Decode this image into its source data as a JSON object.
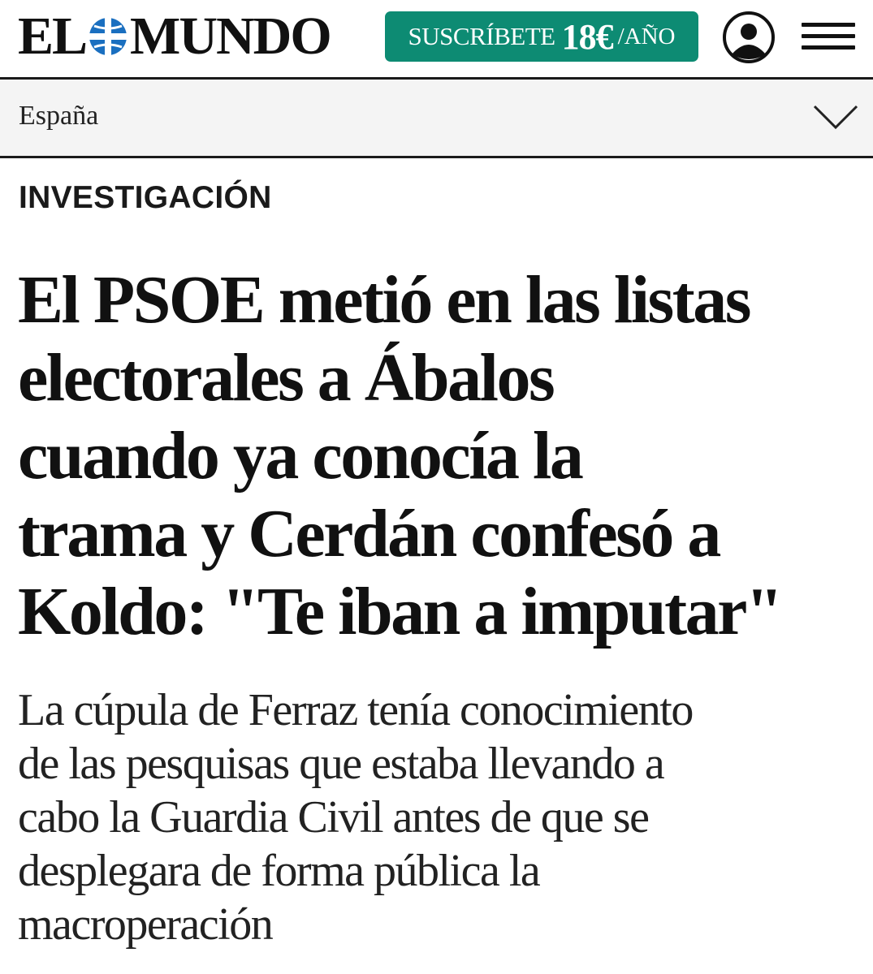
{
  "header": {
    "logo": {
      "left": "EL",
      "right": "MUNDO"
    },
    "subscribe": {
      "label": "SUSCRÍBETE",
      "price": "18€",
      "period": "/AÑO"
    },
    "icons": {
      "user": "user-account-icon",
      "menu": "hamburger-menu-icon"
    },
    "colors": {
      "subscribe_bg": "#0d8b73",
      "logo_globe": "#1a6fc0"
    }
  },
  "section": {
    "label": "España",
    "icon": "chevron-down-icon"
  },
  "article": {
    "kicker": "INVESTIGACIÓN",
    "headline_lines": [
      "El PSOE metió en las listas",
      "electorales a Ábalos",
      "cuando ya conocía la",
      "trama y Cerdán confesó a",
      "Koldo: \"Te iban a imputar\""
    ],
    "standfirst_lines": [
      "La cúpula de Ferraz tenía conocimiento",
      "de las pesquisas que estaba llevando a",
      "cabo la Guardia Civil antes de que se",
      "desplegara de forma pública la",
      "macroperación"
    ]
  }
}
